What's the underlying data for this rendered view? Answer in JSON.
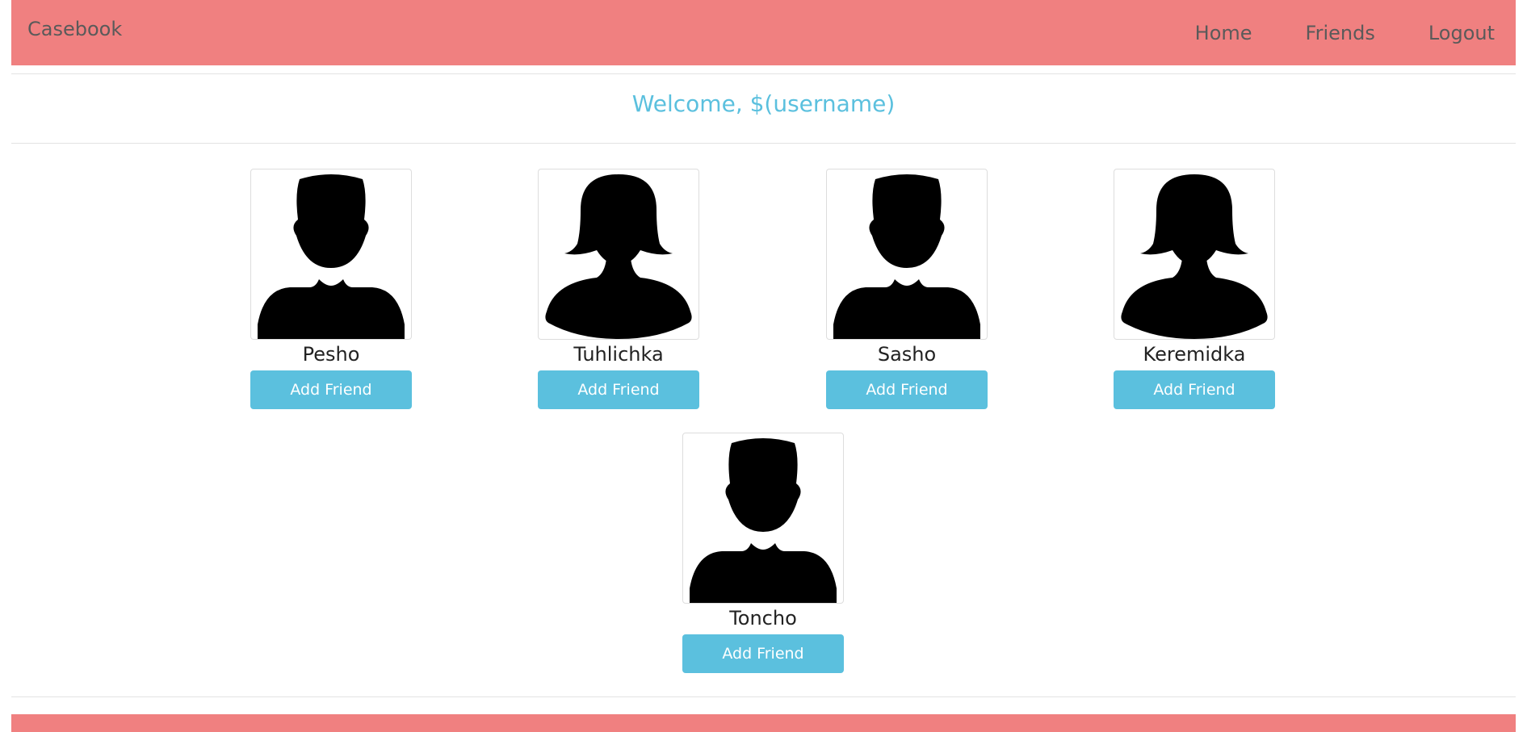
{
  "navbar": {
    "brand": "Casebook",
    "links": [
      {
        "label": "Home"
      },
      {
        "label": "Friends"
      },
      {
        "label": "Logout"
      }
    ]
  },
  "welcome": "Welcome, $(username)",
  "people": [
    {
      "name": "Pesho",
      "avatar": "male-silhouette-icon",
      "button": "Add Friend"
    },
    {
      "name": "Tuhlichka",
      "avatar": "female-silhouette-icon",
      "button": "Add Friend"
    },
    {
      "name": "Sasho",
      "avatar": "male-silhouette-icon",
      "button": "Add Friend"
    },
    {
      "name": "Keremidka",
      "avatar": "female-silhouette-icon",
      "button": "Add Friend"
    },
    {
      "name": "Toncho",
      "avatar": "male-silhouette-icon",
      "button": "Add Friend"
    }
  ],
  "colors": {
    "navbar_bg": "#f08080",
    "accent": "#5bc0de",
    "nav_text": "#5a5a5a"
  }
}
